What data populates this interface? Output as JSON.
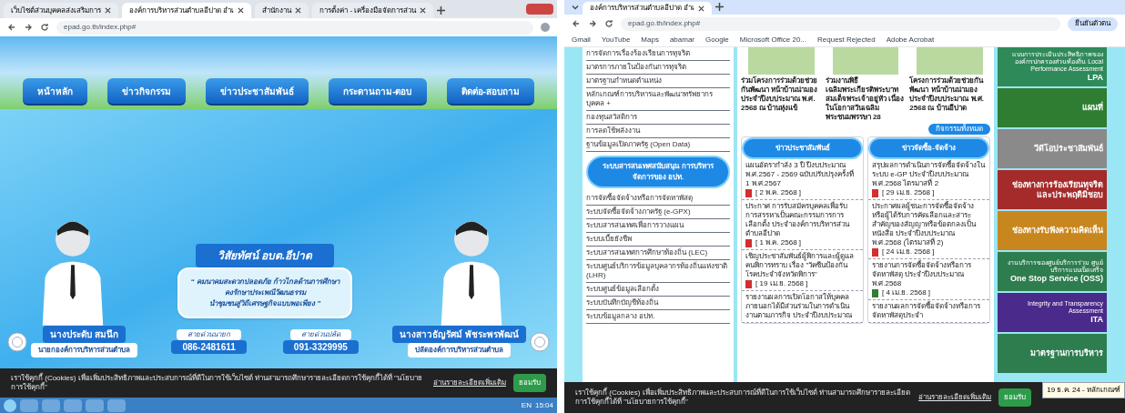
{
  "left_window": {
    "tabs": [
      {
        "title": "เว็บไซต์ส่วนบุคคลส่งเสริมการ",
        "selected": false
      },
      {
        "title": "องค์การบริหารส่วนตำบลอีปาด อำเ",
        "selected": true
      },
      {
        "title": "สำนักงาน",
        "selected": false
      },
      {
        "title": "การตั้งค่า - เครื่องมือจัดการส่วน",
        "selected": false
      }
    ],
    "url": "epad.go.th/index.php#",
    "nav": [
      "หน้าหลัก",
      "ข่าวกิจกรรม",
      "ข่าวประชาสัมพันธ์",
      "กระดานถาม-ตอบ",
      "ติดต่อ-สอบถาม"
    ],
    "vision": {
      "title": "วิสัยทัศน์ อบต.อีปาด",
      "lines": [
        "“ คมนาคมสะดวกปลอดภัย ก้าวไกลด้านการศึกษา",
        "คงรักษาประเพณีวัฒนธรรม",
        "นำชุมชนสู่วิถีเศรษฐกิจแบบพอเพียง ”"
      ]
    },
    "officials": [
      {
        "name": "นางประดับ สมนึก",
        "role": "นายกองค์การบริหารส่วนตำบล",
        "hotline_label": "สายด่วนนายก",
        "phone": "086-2481611"
      },
      {
        "name": "นางสาวธัญรัศม์ พัชระพรพัฒน์",
        "role": "ปลัดองค์การบริหารส่วนตำบล",
        "hotline_label": "สายด่วนปลัด",
        "phone": "091-3329995"
      }
    ],
    "cookie_bar": {
      "text": "เราใช้คุกกี้ (Cookies) เพื่อเพิ่มประสิทธิภาพและประสบการณ์ที่ดีในการใช้เว็บไซต์ ท่านสามารถศึกษารายละเอียดการใช้คุกกี้ได้ที่ \"นโยบายการใช้คุกกี้\"",
      "link": "อ่านรายละเอียดเพิ่มเติม",
      "button": "ยอมรับ"
    },
    "taskbar": {
      "language": "EN",
      "time": "15:04"
    }
  },
  "right_window": {
    "tabs": [
      {
        "title": "องค์การบริหารส่วนตำบลอีปาด อำเ",
        "selected": true
      }
    ],
    "url": "epad.go.th/index.php#",
    "profile": "ยืนยันตัวตน",
    "bookmarks": [
      "Gmail",
      "YouTube",
      "Maps",
      "abamar",
      "Google",
      "Microsoft Office 20...",
      "Request Rejected",
      "Adobe Acrobat"
    ],
    "sidebar_links": [
      "การจัดการเรื่องร้องเรียนการทุจริต",
      "มาตรการภายในป้องกันการทุจริต",
      "มาตรฐานกำหนดตำแหน่ง",
      "หลักเกณฑ์การบริหารและพัฒนาทรัพยากรบุคคล +",
      "กองทุนสวัสดิการ",
      "การลดใช้พลังงาน",
      "ฐานข้อมูลเปิดภาครัฐ (Open Data)"
    ],
    "sidebar_heading": "ระบบสารสนเทศสนับสนุน การบริหารจัดการของ อปท.",
    "system_links": [
      "การจัดซื้อจัดจ้างหรือการจัดหาพัสดุ",
      "ระบบจัดซื้อจัดจ้างภาครัฐ (e-GPX)",
      "ระบบสารสนเทศเพื่อการวางแผน",
      "ระบบเบี้ยยังชีพ",
      "ระบบสารสนเทศการศึกษาท้องถิ่น (LEC)",
      "ระบบศูนย์บริการข้อมูลบุคลากรท้องถิ่นแห่งชาติ (LHR)",
      "ระบบศูนย์ข้อมูลเลือกตั้ง",
      "ระบบบันทึกบัญชีท้องถิ่น",
      "ระบบข้อมูลกลาง อปท."
    ],
    "activities": [
      "ร่วมโครงการร่วมด้วยช่วยกันพัฒนา หน้าบ้านน่ามอง ประจำปีงบประมาณ พ.ศ. 2568 ณ บ้านหุ่งแข้",
      "ร่วมงานพิธีเฉลิมพระเกียรติพระบาทสมเด็จพระเจ้าอยู่หัว เนื่องในโอกาสวันเฉลิมพระชนมพรรษา 28",
      "โครงการร่วมด้วยช่วยกันพัฒนา หน้าบ้านน่ามอง ประจำปีงบประมาณ พ.ศ. 2568 ณ บ้านอีปาด"
    ],
    "more_button": "กิจกรรมทั้งหมด",
    "news_columns": [
      {
        "title": "ข่าวประชาสัมพันธ์",
        "items": [
          {
            "text": "แผนอัตรากำลัง 3 ปี ปีงบประมาณ พ.ศ.2567 - 2569 ฉบับปรับปรุงครั้งที่ 1 พ.ศ.2567",
            "date": "[ 2 พ.ค. 2568 ]",
            "kind": "pdf"
          },
          {
            "text": "ประกาศ การรับสมัครบุคคลเพื่อรับการสรรหาเป็นคณะกรรมการการเลือกตั้ง ประจำองค์การบริหารส่วนตำบลอีปาด",
            "date": "[ 1 พ.ค. 2568 ]",
            "kind": "pdf"
          },
          {
            "text": "เชิญประชาสัมพันธ์ผู้พิการและผู้ดูแลคนพิการทราบ เรื่อง \"วัคซีนป้องกันโรคประจำจังหวัดพิการ\"",
            "date": "[ 19 เม.ย. 2568 ]",
            "kind": "pdf"
          },
          {
            "text": "รายงานผลการเปิดโอกาสให้บุคคลภายนอกได้มีส่วนร่วมในการดำเนินงานตามภารกิจ ประจำปีงบประมาณ"
          }
        ]
      },
      {
        "title": "ข่าวจัดซื้อ-จัดจ้าง",
        "items": [
          {
            "text": "สรุปผลการดำเนินการจัดซื้อจัดจ้างในระบบ e-GP ประจำปีงบประมาณ พ.ศ.2568 ไตรมาสที่ 2",
            "date": "[ 29 เม.ย. 2568 ]",
            "kind": "pdf"
          },
          {
            "text": "ประกาศผลผู้ชนะการจัดซื้อจัดจ้างหรือผู้ได้รับการคัดเลือกและสาระสำคัญของสัญญาหรือข้อตกลงเป็นหนังสือ ประจำปีงบประมาณ พ.ศ.2568 (ไตรมาสที่ 2)",
            "date": "[ 24 เม.ย. 2568 ]",
            "kind": "pdf"
          },
          {
            "text": "รายงานการจัดซื้อจัดจ้างหรือการจัดหาพัสดุ ประจำปีงบประมาณ พ.ศ.2568",
            "date": "[ 4 เม.ย. 2568 ]",
            "kind": "sheet"
          },
          {
            "text": "รายงานผลการจัดซื้อจัดจ้างหรือการจัดหาพัสดุประจำ"
          }
        ]
      }
    ],
    "banners": [
      {
        "title": "LPA",
        "subtitle": "แบบการประเมินประสิทธิภาพขององค์กรปกครองส่วนท้องถิ่น Local Performance Assessment",
        "color": "#2f8a5a"
      },
      {
        "title": "แผนที่",
        "color": "#2e7d32"
      },
      {
        "title": "วีดีโอประชาสัมพันธ์",
        "color": "#8a8a8a"
      },
      {
        "title": "ช่องทางการร้องเรียนทุจริตและประพฤติมิชอบ",
        "color": "#a52a2a"
      },
      {
        "title": "ช่องทางรับฟังความคิดเห็น",
        "color": "#c8861e"
      },
      {
        "title": "One Stop Service (OSS)",
        "subtitle": "งานบริการของศูนย์บริการร่วม ศูนย์บริการแบบเบ็ดเสร็จ",
        "color": "#2e7d4f"
      },
      {
        "title": "ITA",
        "subtitle": "Integrity and Transparency Assessment",
        "color": "#4a2a8a"
      },
      {
        "title": "มาตรฐานการบริหาร",
        "color": "#2e7d4f"
      }
    ],
    "cookie_bar": {
      "text": "เราใช้คุกกี้ (Cookies) เพื่อเพิ่มประสิทธิภาพและประสบการณ์ที่ดีในการใช้เว็บไซต์ ท่านสามารถศึกษารายละเอียดการใช้คุกกี้ได้ที่ \"นโยบายการใช้คุกกี้\"",
      "link": "อ่านรายละเอียดเพิ่มเติม",
      "button": "ยอมรับ"
    },
    "notification": "19 ธ.ค. 24 - หลักเกณฑ์"
  }
}
